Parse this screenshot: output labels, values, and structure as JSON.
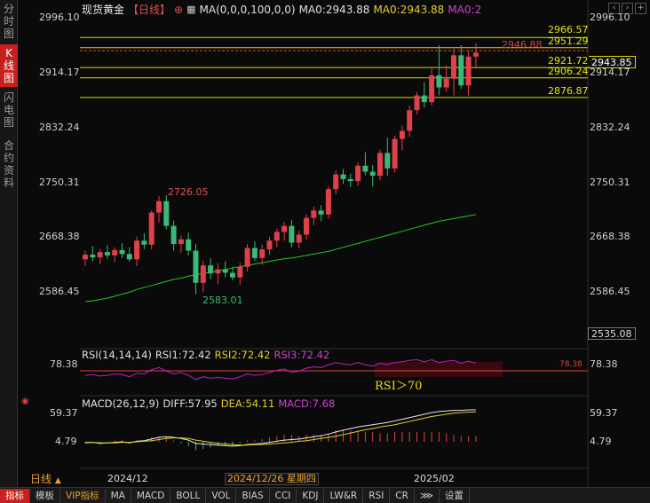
{
  "sidebar": {
    "tabs": [
      {
        "label": "分时图"
      },
      {
        "label": "K线图",
        "active": true
      },
      {
        "label": "闪电图"
      },
      {
        "label": "合约资料"
      }
    ]
  },
  "header": {
    "title": "现货黄金",
    "period": "【日线】",
    "ma_label": "MA(0,0,0,100,0,0)",
    "ma0": "MA0:2943.88",
    "ma0_yellow": "MA0:2943.88",
    "ma0_b": "MA0:2"
  },
  "price_axis": {
    "ticks": [
      "2996.10",
      "2914.17",
      "2832.24",
      "2750.31",
      "2668.38",
      "2586.45"
    ],
    "bottom": "2535.08",
    "current": "2943.85"
  },
  "price_lines": [
    {
      "value": 2966.57,
      "label": "2966.57"
    },
    {
      "value": 2951.29,
      "label": "2951.29"
    },
    {
      "value": 2946.88,
      "label": "2946.88"
    },
    {
      "value": 2921.72,
      "label": "2921.72"
    },
    {
      "value": 2906.24,
      "label": "2906.24"
    },
    {
      "value": 2876.87,
      "label": "2876.87"
    }
  ],
  "annotations": {
    "high": "2726.05",
    "low": "2583.01"
  },
  "rsi": {
    "label": "RSI(14,14,14)",
    "rsi1": "RSI1:72.42",
    "rsi2": "RSI2:72.42",
    "rsi3": "RSI3:72.42",
    "level": "78.38",
    "right_level": "78.38",
    "overlay": "78.38",
    "note": "RSI＞70"
  },
  "macd": {
    "label": "MACD(26,12,9)",
    "diff": "DIFF:57.95",
    "dea": "DEA:54.11",
    "macd": "MACD:7.68",
    "top": "59.37",
    "bottom": "4.79",
    "right_top": "59.37",
    "right_bottom": "4.79"
  },
  "time_axis": {
    "period": "日线",
    "d1": "2024/12",
    "cursor": "2024/12/26 星期四",
    "d2": "2025/02"
  },
  "toolbar": {
    "items": [
      {
        "label": "指标",
        "cls": "act"
      },
      {
        "label": "模板"
      },
      {
        "label": "VIP指标",
        "cls": "vip"
      },
      {
        "label": "MA"
      },
      {
        "label": "MACD"
      },
      {
        "label": "BOLL"
      },
      {
        "label": "VOL"
      },
      {
        "label": "BIAS"
      },
      {
        "label": "CCI"
      },
      {
        "label": "KDJ"
      },
      {
        "label": "LW&R"
      },
      {
        "label": "RSI"
      },
      {
        "label": "CR"
      },
      {
        "label": "⋙"
      },
      {
        "label": "设置"
      }
    ]
  },
  "colors": {
    "up": "#e0404a",
    "down": "#3cb878",
    "ma": "#22c522",
    "line": "#d8d800",
    "rsi": "#c020c0",
    "diff": "#e8e8e8",
    "dea": "#e0d020",
    "macd": "#e04040"
  },
  "chart_data": {
    "type": "candlestick",
    "ohlc": [
      [
        2635,
        2648,
        2625,
        2642
      ],
      [
        2642,
        2655,
        2632,
        2638
      ],
      [
        2638,
        2651,
        2628,
        2646
      ],
      [
        2646,
        2656,
        2636,
        2641
      ],
      [
        2641,
        2653,
        2631,
        2649
      ],
      [
        2649,
        2659,
        2637,
        2643
      ],
      [
        2643,
        2653,
        2632,
        2635
      ],
      [
        2635,
        2669,
        2625,
        2663
      ],
      [
        2663,
        2674,
        2650,
        2657
      ],
      [
        2657,
        2708,
        2650,
        2705
      ],
      [
        2705,
        2730,
        2690,
        2722
      ],
      [
        2722,
        2731,
        2680,
        2685
      ],
      [
        2685,
        2693,
        2648,
        2658
      ],
      [
        2658,
        2671,
        2645,
        2665
      ],
      [
        2665,
        2675,
        2641,
        2648
      ],
      [
        2648,
        2658,
        2583,
        2600
      ],
      [
        2600,
        2633,
        2586,
        2626
      ],
      [
        2626,
        2637,
        2605,
        2614
      ],
      [
        2614,
        2629,
        2598,
        2620
      ],
      [
        2620,
        2632,
        2608,
        2615
      ],
      [
        2615,
        2624,
        2604,
        2608
      ],
      [
        2608,
        2630,
        2597,
        2624
      ],
      [
        2624,
        2658,
        2617,
        2652
      ],
      [
        2652,
        2662,
        2633,
        2637
      ],
      [
        2637,
        2657,
        2627,
        2650
      ],
      [
        2650,
        2669,
        2642,
        2663
      ],
      [
        2663,
        2681,
        2653,
        2676
      ],
      [
        2676,
        2691,
        2663,
        2685
      ],
      [
        2685,
        2694,
        2653,
        2660
      ],
      [
        2660,
        2678,
        2652,
        2672
      ],
      [
        2672,
        2702,
        2664,
        2697
      ],
      [
        2697,
        2714,
        2686,
        2708
      ],
      [
        2708,
        2716,
        2692,
        2702
      ],
      [
        2702,
        2744,
        2696,
        2740
      ],
      [
        2740,
        2768,
        2732,
        2762
      ],
      [
        2762,
        2770,
        2748,
        2755
      ],
      [
        2755,
        2763,
        2743,
        2752
      ],
      [
        2752,
        2780,
        2745,
        2775
      ],
      [
        2775,
        2795,
        2761,
        2766
      ],
      [
        2766,
        2776,
        2744,
        2760
      ],
      [
        2760,
        2799,
        2753,
        2794
      ],
      [
        2794,
        2817,
        2760,
        2771
      ],
      [
        2771,
        2820,
        2765,
        2815
      ],
      [
        2815,
        2835,
        2798,
        2827
      ],
      [
        2827,
        2865,
        2818,
        2858
      ],
      [
        2858,
        2885,
        2852,
        2880
      ],
      [
        2880,
        2900,
        2862,
        2870
      ],
      [
        2870,
        2920,
        2865,
        2910
      ],
      [
        2910,
        2955,
        2880,
        2892
      ],
      [
        2892,
        2925,
        2885,
        2905
      ],
      [
        2905,
        2950,
        2880,
        2940
      ],
      [
        2940,
        2955,
        2890,
        2895
      ],
      [
        2895,
        2948,
        2880,
        2938
      ],
      [
        2938,
        2958,
        2920,
        2944
      ]
    ],
    "ma100": [
      2572,
      2573,
      2575,
      2577,
      2580,
      2583,
      2586,
      2590,
      2593,
      2596,
      2599,
      2602,
      2605,
      2607,
      2610,
      2612,
      2614,
      2616,
      2618,
      2620,
      2622,
      2624,
      2626,
      2628,
      2630,
      2632,
      2634,
      2636,
      2637,
      2639,
      2641,
      2643,
      2645,
      2647,
      2650,
      2653,
      2656,
      2659,
      2662,
      2665,
      2668,
      2671,
      2674,
      2677,
      2680,
      2683,
      2686,
      2689,
      2692,
      2694,
      2696,
      2698,
      2700,
      2702
    ],
    "rsi": [
      55,
      56,
      54,
      55,
      57,
      56,
      53,
      58,
      57,
      63,
      66,
      61,
      57,
      59,
      55,
      49,
      53,
      51,
      52,
      51,
      50,
      53,
      57,
      55,
      56,
      59,
      62,
      64,
      59,
      61,
      65,
      67,
      66,
      70,
      73,
      71,
      70,
      73,
      70,
      68,
      72,
      70,
      73,
      74,
      76,
      77,
      74,
      77,
      73,
      75,
      76,
      72,
      75,
      72
    ],
    "macd_diff": [
      -2,
      -1,
      -3,
      -2,
      -1,
      0,
      -2,
      1,
      2,
      5,
      8,
      9,
      8,
      6,
      3,
      -3,
      -4,
      -5,
      -6,
      -7,
      -8,
      -7,
      -5,
      -4,
      -3,
      -1,
      1,
      3,
      4,
      5,
      7,
      9,
      11,
      14,
      18,
      21,
      24,
      27,
      29,
      31,
      33,
      35,
      38,
      41,
      44,
      47,
      50,
      53,
      55,
      56,
      57,
      57,
      58,
      58
    ],
    "macd_dea": [
      -1,
      -1,
      -2,
      -2,
      -2,
      -1,
      -1,
      0,
      1,
      2,
      4,
      6,
      7,
      7,
      6,
      3,
      1,
      -1,
      -3,
      -4,
      -5,
      -6,
      -6,
      -5,
      -5,
      -4,
      -3,
      -2,
      -1,
      1,
      2,
      4,
      6,
      8,
      10,
      13,
      16,
      19,
      22,
      24,
      27,
      29,
      31,
      34,
      37,
      40,
      43,
      46,
      48,
      50,
      52,
      53,
      54,
      54
    ]
  }
}
